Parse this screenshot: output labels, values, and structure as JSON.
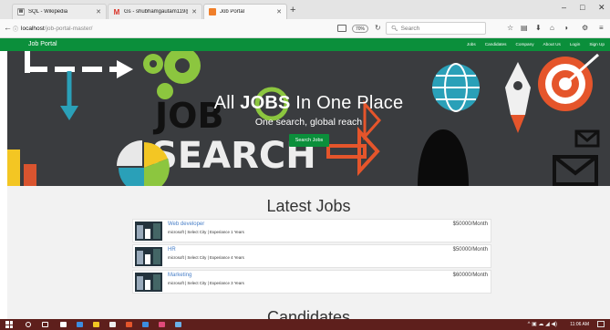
{
  "browser": {
    "tabs": [
      {
        "label": "SQL - Wikipedia",
        "favicon": "W",
        "active": false
      },
      {
        "label": "Gs - shubhamgautam119@...",
        "favicon": "M",
        "active": false
      },
      {
        "label": "Job Portal",
        "favicon": "",
        "active": true
      }
    ],
    "url_host": "localhost",
    "url_path": "/job-portal-master/",
    "zoom": "70%",
    "search_placeholder": "Search"
  },
  "site": {
    "brand": "Job Portal",
    "nav_links": [
      "Jobs",
      "Candidates",
      "Company",
      "About Us",
      "Login",
      "Sign Up"
    ],
    "accent_color": "#0b8f3b"
  },
  "hero": {
    "title_prefix": "All ",
    "title_bold": "JOBS",
    "title_suffix": " In One Place",
    "subtitle": "One search, global reach",
    "button_label": "Search Jobs",
    "bg_words": [
      "JOB",
      "SEARCH"
    ]
  },
  "latest_jobs": {
    "title": "Latest Jobs",
    "jobs": [
      {
        "title": "Web developer",
        "meta": "microsoft | Select City | Experiance 1 Years",
        "salary": "$50000/Month"
      },
      {
        "title": "HR",
        "meta": "microsoft | Select City | Experiance 4 Years",
        "salary": "$50000/Month"
      },
      {
        "title": "Marketing",
        "meta": "microsoft | Select City | Experiance 3 Years",
        "salary": "$60000/Month"
      }
    ]
  },
  "candidates": {
    "title": "Candidates"
  },
  "taskbar": {
    "time": "11:06 AM"
  }
}
